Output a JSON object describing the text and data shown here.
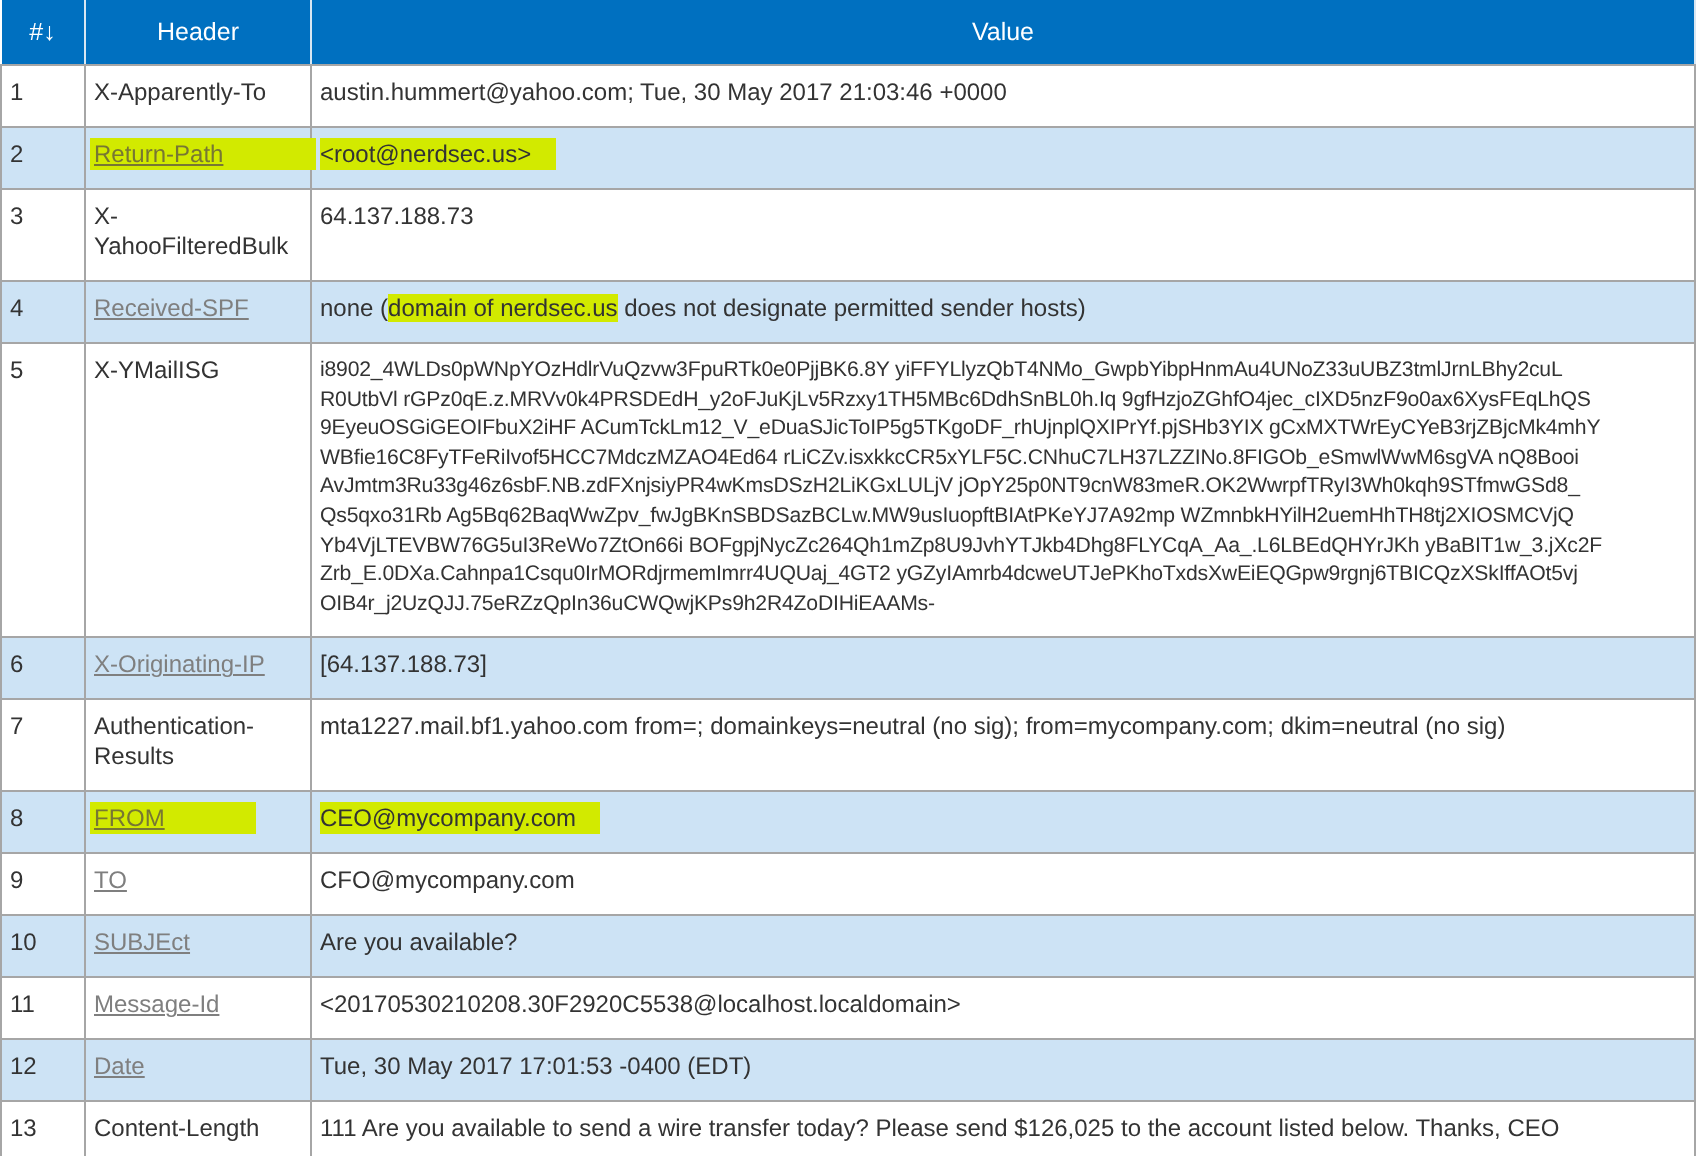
{
  "table": {
    "columns": [
      {
        "label": "#↓"
      },
      {
        "label": "Header"
      },
      {
        "label": "Value"
      }
    ],
    "rows": [
      {
        "number": "1",
        "header": "X-Apparently-To",
        "header_link": false,
        "highlighted": false,
        "kind": "plain",
        "value": "austin.hummert@yahoo.com; Tue, 30 May 2017 21:03:46 +0000"
      },
      {
        "number": "2",
        "header": "Return-Path",
        "header_link": true,
        "highlighted": true,
        "kind": "plain",
        "value": "<root@nerdsec.us>"
      },
      {
        "number": "3",
        "header": "X-YahooFilteredBulk",
        "header_link": false,
        "highlighted": false,
        "kind": "plain",
        "value": "64.137.188.73"
      },
      {
        "number": "4",
        "header": "Received-SPF",
        "header_link": true,
        "highlighted": false,
        "kind": "segments",
        "segments": [
          {
            "text": "none (",
            "highlighted": false
          },
          {
            "text": "domain of nerdsec.us",
            "highlighted": true
          },
          {
            "text": " does not designate permitted sender hosts)",
            "highlighted": false
          }
        ]
      },
      {
        "number": "5",
        "header": "X-YMailISG",
        "header_link": false,
        "highlighted": false,
        "kind": "lines",
        "lines": [
          "i8902_4WLDs0pWNpYOzHdlrVuQzvw3FpuRTk0e0PjjBK6.8Y yiFFYLlyzQbT4NMo_GwpbYibpHnmAu4UNoZ33uUBZ3tmlJrnLBhy2cuL",
          "R0UtbVl rGPz0qE.z.MRVv0k4PRSDEdH_y2oFJuKjLv5Rzxy1TH5MBc6DdhSnBL0h.Iq 9gfHzjoZGhfO4jec_cIXD5nzF9o0ax6XysFEqLhQS",
          "9EyeuOSGiGEOIFbuX2iHF ACumTckLm12_V_eDuaSJicToIP5g5TKgoDF_rhUjnplQXIPrYf.pjSHb3YIX gCxMXTWrEyCYeB3rjZBjcMk4mhY",
          "WBfie16C8FyTFeRiIvof5HCC7MdczMZAO4Ed64 rLiCZv.isxkkcCR5xYLF5C.CNhuC7LH37LZZINo.8FIGOb_eSmwlWwM6sgVA nQ8Booi",
          "AvJmtm3Ru33g46z6sbF.NB.zdFXnjsiyPR4wKmsDSzH2LiKGxLULjV jOpY25p0NT9cnW83meR.OK2WwrpfTRyI3Wh0kqh9STfmwGSd8_",
          "Qs5qxo31Rb Ag5Bq62BaqWwZpv_fwJgBKnSBDSazBCLw.MW9usIuopftBIAtPKeYJ7A92mp WZmnbkHYilH2uemHhTH8tj2XIOSMCVjQ",
          "Yb4VjLTEVBW76G5uI3ReWo7ZtOn66i BOFgpjNycZc264Qh1mZp8U9JvhYTJkb4Dhg8FLYCqA_Aa_.L6LBEdQHYrJKh yBaBIT1w_3.jXc2F",
          "Zrb_E.0DXa.Cahnpa1Csqu0IrMORdjrmemImrr4UQUaj_4GT2 yGZyIAmrb4dcweUTJePKhoTxdsXwEiEQGpw9rgnj6TBICQzXSkIffAOt5vj",
          "OIB4r_j2UzQJJ.75eRZzQpIn36uCWQwjKPs9h2R4ZoDIHiEAAMs-"
        ]
      },
      {
        "number": "6",
        "header": "X-Originating-IP",
        "header_link": true,
        "highlighted": false,
        "kind": "plain",
        "value": "[64.137.188.73]"
      },
      {
        "number": "7",
        "header": "Authentication-Results",
        "header_link": false,
        "highlighted": false,
        "kind": "plain",
        "value": "mta1227.mail.bf1.yahoo.com from=; domainkeys=neutral (no sig); from=mycompany.com; dkim=neutral (no sig)"
      },
      {
        "number": "8",
        "header": "FROM",
        "header_link": true,
        "highlighted": true,
        "kind": "plain",
        "value": "CEO@mycompany.com"
      },
      {
        "number": "9",
        "header": "TO",
        "header_link": true,
        "highlighted": false,
        "kind": "plain",
        "value": "CFO@mycompany.com"
      },
      {
        "number": "10",
        "header": "SUBJEct",
        "header_link": true,
        "highlighted": false,
        "kind": "plain",
        "value": "Are you available?"
      },
      {
        "number": "11",
        "header": "Message-Id",
        "header_link": true,
        "highlighted": false,
        "kind": "plain",
        "value": "<20170530210208.30F2920C5538@localhost.localdomain>"
      },
      {
        "number": "12",
        "header": "Date",
        "header_link": true,
        "highlighted": false,
        "kind": "plain",
        "value": "Tue, 30 May 2017 17:01:53 -0400 (EDT)"
      },
      {
        "number": "13",
        "header": "Content-Length",
        "header_link": false,
        "highlighted": false,
        "kind": "plain",
        "value": "111 Are you available to send a wire transfer today? Please send $126,025 to the account listed below. Thanks, CEO"
      }
    ]
  }
}
